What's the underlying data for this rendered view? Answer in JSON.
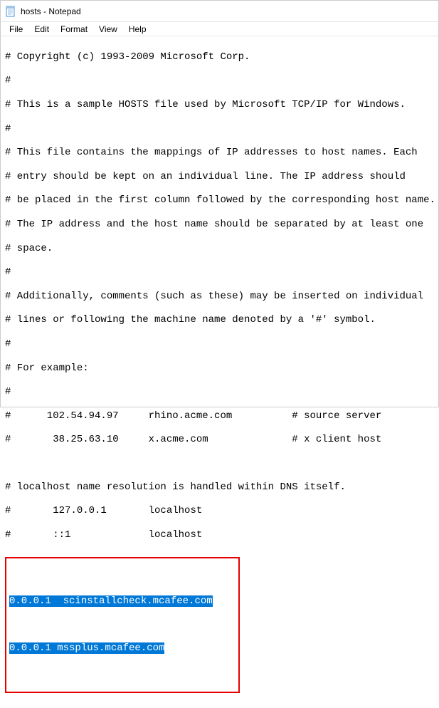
{
  "window": {
    "title": "hosts - Notepad"
  },
  "menu": {
    "file": "File",
    "edit": "Edit",
    "format": "Format",
    "view": "View",
    "help": "Help"
  },
  "content": {
    "line1": "# Copyright (c) 1993-2009 Microsoft Corp.",
    "line2": "#",
    "line3": "# This is a sample HOSTS file used by Microsoft TCP/IP for Windows.",
    "line4": "#",
    "line5": "# This file contains the mappings of IP addresses to host names. Each",
    "line6": "# entry should be kept on an individual line. The IP address should",
    "line7": "# be placed in the first column followed by the corresponding host name.",
    "line8": "# The IP address and the host name should be separated by at least one",
    "line9": "# space.",
    "line10": "#",
    "line11": "# Additionally, comments (such as these) may be inserted on individual",
    "line12": "# lines or following the machine name denoted by a '#' symbol.",
    "line13": "#",
    "line14": "# For example:",
    "line15": "#",
    "line16": "#      102.54.94.97     rhino.acme.com          # source server",
    "line17": "#       38.25.63.10     x.acme.com              # x client host",
    "line18": "",
    "line19": "# localhost name resolution is handled within DNS itself.",
    "line20": "#       127.0.0.1       localhost",
    "line21": "#       ::1             localhost",
    "highlighted1": "0.0.0.1  scinstallcheck.mcafee.com",
    "highlighted2": "0.0.0.1 mssplus.mcafee.com"
  }
}
